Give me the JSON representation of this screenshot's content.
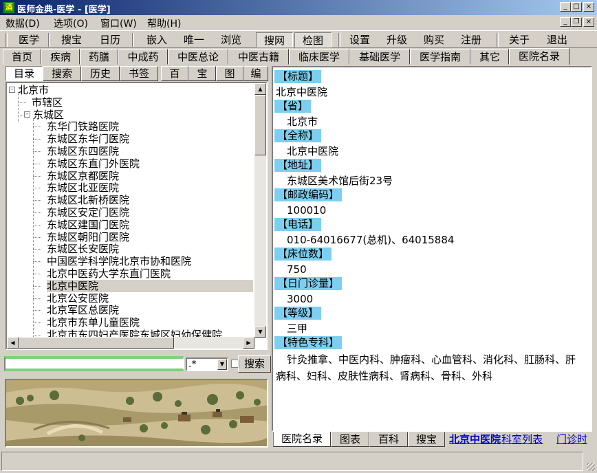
{
  "window": {
    "title": "医师金典-医学 - [医学]",
    "icon_glyph": "酒"
  },
  "menu": [
    "数据(D)",
    "选项(O)",
    "窗口(W)",
    "帮助(H)"
  ],
  "toolbar": [
    "医学",
    "搜宝",
    "日历",
    "嵌入",
    "唯一",
    "浏览",
    "搜网",
    "检图",
    "设置",
    "升级",
    "购买",
    "注册",
    "关于",
    "退出"
  ],
  "main_tabs": [
    "首页",
    "疾病",
    "药膳",
    "中成药",
    "中医总论",
    "中医古籍",
    "临床医学",
    "基础医学",
    "医学指南",
    "其它",
    "医院名录"
  ],
  "left_tabs": [
    "目录",
    "搜索",
    "历史",
    "书签",
    "百",
    "宝",
    "图",
    "编"
  ],
  "tree": [
    {
      "label": "北京市",
      "level": 0,
      "expander": "-"
    },
    {
      "label": "市辖区",
      "level": 1,
      "expander": ""
    },
    {
      "label": "东城区",
      "level": 1,
      "expander": "-"
    },
    {
      "label": "东华门铁路医院",
      "level": 2
    },
    {
      "label": "东城区东华门医院",
      "level": 2
    },
    {
      "label": "东城区东四医院",
      "level": 2
    },
    {
      "label": "东城区东直门外医院",
      "level": 2
    },
    {
      "label": "东城区京都医院",
      "level": 2
    },
    {
      "label": "东城区北亚医院",
      "level": 2
    },
    {
      "label": "东城区北新桥医院",
      "level": 2
    },
    {
      "label": "东城区安定门医院",
      "level": 2
    },
    {
      "label": "东城区建国门医院",
      "level": 2
    },
    {
      "label": "东城区朝阳门医院",
      "level": 2
    },
    {
      "label": "东城区长安医院",
      "level": 2
    },
    {
      "label": "中国医学科学院北京市协和医院",
      "level": 2
    },
    {
      "label": "北京中医药大学东直门医院",
      "level": 2
    },
    {
      "label": "北京中医院",
      "level": 2,
      "selected": true
    },
    {
      "label": "北京公安医院",
      "level": 2
    },
    {
      "label": "北京军区总医院",
      "level": 2
    },
    {
      "label": "北京市东单儿童医院",
      "level": 2
    },
    {
      "label": "北京市东四妇产医院东城区妇幼保健院",
      "level": 2
    }
  ],
  "search": {
    "value": "",
    "regex_value": ".*",
    "button_label": "搜索"
  },
  "content": {
    "title_label": "【标题】",
    "title_value": "北京中医院",
    "fields": [
      {
        "label": "【省】",
        "value": "北京市"
      },
      {
        "label": "【全称】",
        "value": "北京中医院"
      },
      {
        "label": "【地址】",
        "value": "东城区美术馆后街23号"
      },
      {
        "label": "【邮政编码】",
        "value": "100010"
      },
      {
        "label": "【电话】",
        "value": "010-64016677(总机)、64015884"
      },
      {
        "label": "【床位数】",
        "value": "750"
      },
      {
        "label": "【日门诊量】",
        "value": "3000"
      },
      {
        "label": "【等级】",
        "value": "三甲"
      },
      {
        "label": "【特色专科】",
        "value": "针灸推拿、中医内科、肿瘤科、心血管科、消化科、肛肠科、肝病科、妇科、皮肤性病科、肾病科、骨科、外科"
      }
    ]
  },
  "bottom_tabs": [
    "医院名录",
    "图表",
    "百科",
    "搜宝"
  ],
  "bottom_links": {
    "hospital": "北京中医院",
    "dept_list": "科室列表",
    "clinic_time": "门诊时"
  },
  "colors": {
    "label_bg": "#7ccff0",
    "title_gradient_start": "#0a246a",
    "link": "#0000cc"
  }
}
